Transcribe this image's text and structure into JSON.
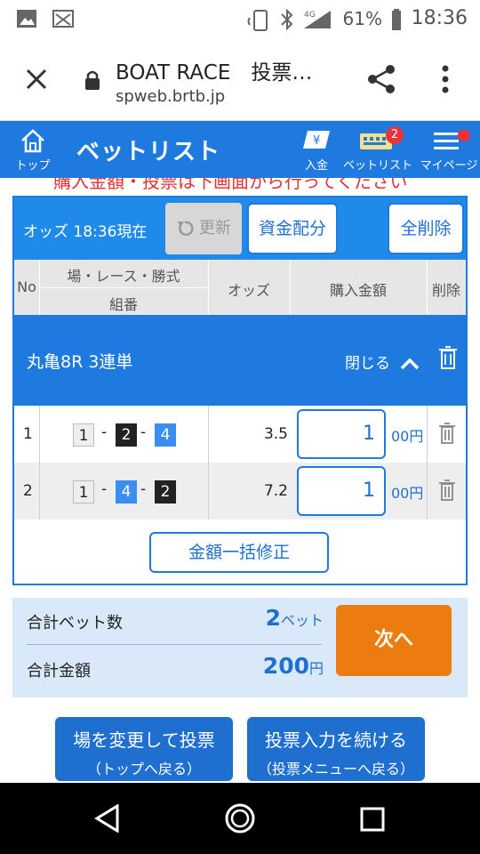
{
  "status_bar": {
    "battery_percent": "61%",
    "time": "18:36",
    "network": "4G"
  },
  "browser": {
    "title": "BOAT RACE　投票…",
    "url": "spweb.brtb.jp"
  },
  "app_bar": {
    "title": "ベットリスト",
    "home_label": "トップ",
    "deposit_label": "入金",
    "betlist_label": "ベットリスト",
    "betlist_badge": "2",
    "mypage_label": "マイページ"
  },
  "banner_text": "購入金額・投票は下画面から行ってください",
  "odds_bar": {
    "odds_label": "オッズ 18:36現在",
    "refresh_label": "更新",
    "allocate_label": "資金配分",
    "delete_all_label": "全削除"
  },
  "table_header": {
    "no": "No",
    "race_type": "場・レース・勝式",
    "combination": "組番",
    "odds": "オッズ",
    "amount": "購入金額",
    "delete": "削除"
  },
  "group": {
    "name": "丸亀8R 3連単",
    "close_label": "閉じる"
  },
  "bets": [
    {
      "no": "1",
      "combo": [
        "1",
        "2",
        "4"
      ],
      "odds": "3.5",
      "amount": "1",
      "unit": "00円"
    },
    {
      "no": "2",
      "combo": [
        "1",
        "4",
        "2"
      ],
      "odds": "7.2",
      "amount": "1",
      "unit": "00円"
    }
  ],
  "bulk_edit_label": "金額一括修正",
  "summary": {
    "bet_count_label": "合計ベット数",
    "bet_count_value": "2",
    "bet_count_unit": "ベット",
    "total_label": "合計金額",
    "total_value": "200",
    "total_unit": "円",
    "next_label": "次へ"
  },
  "bottom_buttons": [
    {
      "line1": "場を変更して投票",
      "line2": "（トップへ戻る）"
    },
    {
      "line1": "投票入力を続ける",
      "line2": "（投票メニューへ戻る）"
    }
  ],
  "colors": {
    "primary": "#1f7ae0",
    "accent_orange": "#ed7c10",
    "summary_bg": "#d9e9f9",
    "badge_red": "#e8333a"
  },
  "icons": [
    "image-icon",
    "cast-icon",
    "nfc-icon",
    "bluetooth-icon",
    "signal-icon",
    "battery-icon",
    "close-icon",
    "lock-icon",
    "share-icon",
    "more-vert-icon",
    "home-icon",
    "deposit-icon",
    "betlist-icon",
    "menu-icon",
    "refresh-icon",
    "chevron-up-icon",
    "trash-icon",
    "back-nav-icon",
    "home-nav-icon",
    "recents-nav-icon"
  ]
}
